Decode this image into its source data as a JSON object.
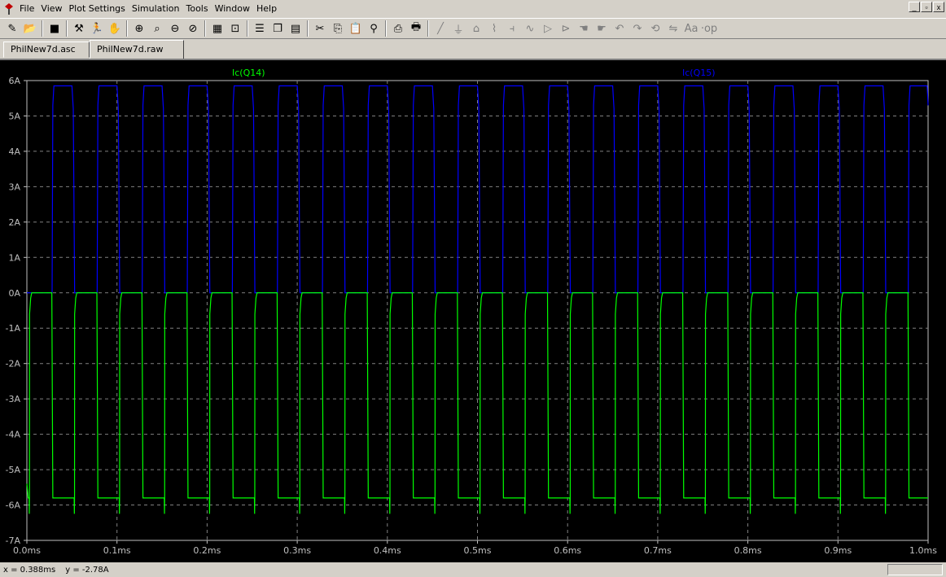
{
  "menu": [
    "File",
    "View",
    "Plot Settings",
    "Simulation",
    "Tools",
    "Window",
    "Help"
  ],
  "window_controls": [
    "_",
    "▫",
    "x"
  ],
  "toolbar": [
    "new-schematic-icon",
    "open-icon",
    "sep",
    "save-icon",
    "sep",
    "control-panel-icon",
    "run-icon",
    "halt-icon",
    "sep",
    "zoom-in-icon",
    "zoom-area-icon",
    "zoom-out-icon",
    "zoom-cancel-icon",
    "sep",
    "autorange-icon",
    "mark-icon",
    "sep",
    "tile-horizontal-icon",
    "cascade-icon",
    "tile-vertical-icon",
    "sep",
    "cut-icon",
    "copy-icon",
    "paste-icon",
    "find-icon",
    "sep",
    "print-preview-icon",
    "print-icon",
    "sep",
    "wire-icon",
    "ground-icon",
    "label-icon",
    "resistor-icon",
    "capacitor-icon",
    "inductor-icon",
    "diode-icon",
    "component-icon",
    "move-icon",
    "drag-icon",
    "undo-icon",
    "redo-icon",
    "rotate-icon",
    "mirror-icon",
    "text-icon",
    "spice-directive-icon"
  ],
  "tabs": [
    {
      "label": "PhilNew7d.asc",
      "active": false
    },
    {
      "label": "PhilNew7d.raw",
      "active": true
    }
  ],
  "status": {
    "x": "x = 0.388ms",
    "y": "y = -2.78A"
  },
  "colors": {
    "q14": "#00ff00",
    "q15": "#0000ff",
    "grid": "#808080",
    "axis": "#c0c0c0"
  },
  "chart_data": {
    "type": "line",
    "xlabel": "",
    "ylabel": "",
    "xlim": [
      0,
      1.0
    ],
    "ylim": [
      -7,
      6
    ],
    "x_ticks": [
      0,
      0.1,
      0.2,
      0.3,
      0.4,
      0.5,
      0.6,
      0.7,
      0.8,
      0.9,
      1.0
    ],
    "x_tick_labels": [
      "0.0ms",
      "0.1ms",
      "0.2ms",
      "0.3ms",
      "0.4ms",
      "0.5ms",
      "0.6ms",
      "0.7ms",
      "0.8ms",
      "0.9ms",
      "1.0ms"
    ],
    "y_ticks": [
      6,
      5,
      4,
      3,
      2,
      1,
      0,
      -1,
      -2,
      -3,
      -4,
      -5,
      -6,
      -7
    ],
    "y_tick_labels": [
      "6A",
      "5A",
      "4A",
      "3A",
      "2A",
      "1A",
      "0A",
      "-1A",
      "-2A",
      "-3A",
      "-4A",
      "-5A",
      "-6A",
      "-7A"
    ],
    "grid": true,
    "series": [
      {
        "name": "Ic(Q14)",
        "high": 0,
        "low": -5.8,
        "spike": -6.25,
        "period_ms": 0.05,
        "on_from": 0.003,
        "on_to": 0.028
      },
      {
        "name": "Ic(Q15)",
        "high": 5.85,
        "low": 0,
        "period_ms": 0.05,
        "on_from": 0.028,
        "on_to": 0.053
      }
    ]
  }
}
